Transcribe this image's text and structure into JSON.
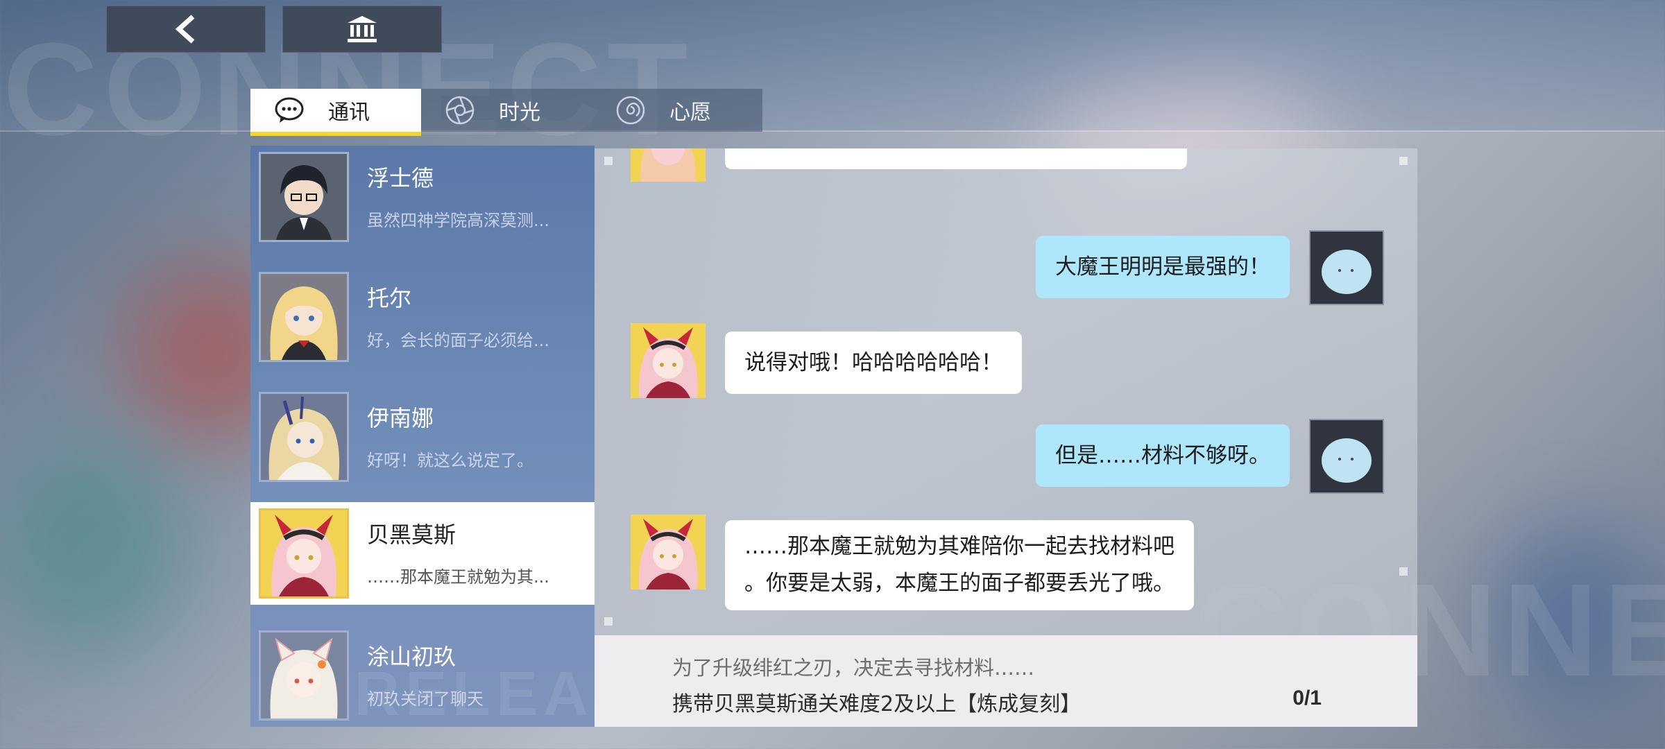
{
  "background": {
    "watermark_top": "CONNECT",
    "watermark_bottom": "CONNECT",
    "watermark_list": "RELEASE"
  },
  "top_bar": {
    "back_icon": "chevron-left-icon",
    "home_icon": "bank-building-icon"
  },
  "tabs": [
    {
      "label": "通讯",
      "icon": "chat-bubble-icon",
      "active": true
    },
    {
      "label": "时光",
      "icon": "aperture-icon",
      "active": false
    },
    {
      "label": "心愿",
      "icon": "spiral-icon",
      "active": false
    }
  ],
  "contacts": [
    {
      "name": "浮士德",
      "preview": "虽然四神学院高深莫测...",
      "selected": false
    },
    {
      "name": "托尔",
      "preview": "好，会长的面子必须给...",
      "selected": false
    },
    {
      "name": "伊南娜",
      "preview": "好呀！就这么说定了。",
      "selected": false
    },
    {
      "name": "贝黑莫斯",
      "preview": "……那本魔王就勉为其...",
      "selected": true
    },
    {
      "name": "涂山初玖",
      "preview": "初玖关闭了聊天",
      "selected": false
    }
  ],
  "chat": {
    "messages": [
      {
        "side": "right",
        "text": "大魔王明明是最强的！"
      },
      {
        "side": "left",
        "text": "说得对哦！哈哈哈哈哈哈！"
      },
      {
        "side": "right",
        "text": "但是……材料不够呀。"
      },
      {
        "side": "left",
        "line1": "……那本魔王就勉为其难陪你一起去找材料吧",
        "line2": "。你要是太弱，本魔王的面子都要丢光了哦。"
      }
    ]
  },
  "quest": {
    "description": "为了升级绯红之刃，决定去寻找材料……",
    "task": "携带贝黑莫斯通关难度2及以上【炼成复刻】",
    "progress": "0/1"
  },
  "colors": {
    "tab_active_underline": "#f3d52b",
    "bubble_self": "#aee6fb",
    "bubble_other": "#ffffff",
    "contact_list_bg": "#6f8cb8"
  }
}
